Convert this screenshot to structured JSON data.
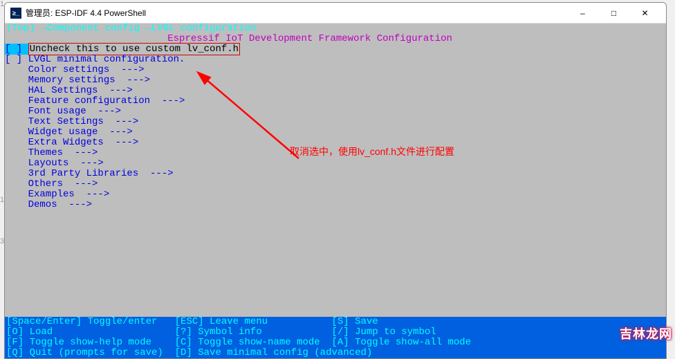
{
  "window": {
    "title": "管理员: ESP-IDF 4.4 PowerShell",
    "icon_text": "≥_"
  },
  "breadcrumb": "(Top) →Component config →LVGL configuration",
  "banner_spaces": "                            Espressif IoT Development Framework Configuration",
  "menu": {
    "selected_prefix": "[ ] ",
    "selected_label": "Uncheck this to use custom lv_conf.h",
    "items": [
      "[ ] LVGL minimal configuration.",
      "    Color settings  --->",
      "    Memory settings  --->",
      "    HAL Settings  --->",
      "    Feature configuration  --->",
      "    Font usage  --->",
      "    Text Settings  --->",
      "    Widget usage  --->",
      "    Extra Widgets  --->",
      "    Themes  --->",
      "    Layouts  --->",
      "    3rd Party Libraries  --->",
      "    Others  --->",
      "    Examples  --->",
      "    Demos  --->"
    ]
  },
  "footer": {
    "l1": "[Space/Enter] Toggle/enter   [ESC] Leave menu           [S] Save",
    "l2": "[O] Load                     [?] Symbol info            [/] Jump to symbol",
    "l3": "[F] Toggle show-help mode    [C] Toggle show-name mode  [A] Toggle show-all mode",
    "l4": "[Q] Quit (prompts for save)  [D] Save minimal config (advanced)"
  },
  "annotation": "取消选中，使用lv_conf.h文件进行配置",
  "watermark": "吉林龙网",
  "gutter1": "1",
  "gutter2": "1!",
  "gutter3": "3、"
}
